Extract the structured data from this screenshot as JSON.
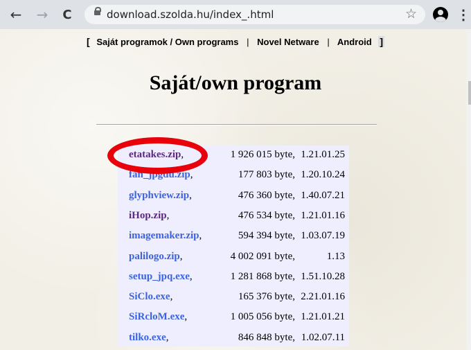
{
  "browser": {
    "url": "download.szolda.hu/index_.html",
    "back_glyph": "←",
    "forward_glyph": "→",
    "reload_glyph": "C",
    "star_glyph": "☆",
    "menu_glyph": "⋮"
  },
  "nav": {
    "open_bracket": "[",
    "items": [
      "Saját programok / Own programs",
      "Novel Netware",
      "Android"
    ],
    "separator": "|",
    "close_bracket": "]"
  },
  "page_title": "Saját/own program",
  "comma": ",",
  "files": [
    {
      "name": "etatakes.zip",
      "size": "1 926 015 byte,",
      "version": "1.21.01.25",
      "visited": true
    },
    {
      "name": "fan_jpgdu.zip",
      "size": "177 803 byte,",
      "version": "1.20.10.24",
      "visited": false
    },
    {
      "name": "glyphview.zip",
      "size": "476 360 byte,",
      "version": "1.40.07.21",
      "visited": false
    },
    {
      "name": "iHop.zip",
      "size": "476 534 byte,",
      "version": "1.21.01.16",
      "visited": true
    },
    {
      "name": "imagemaker.zip",
      "size": "594 394 byte,",
      "version": "1.03.07.19",
      "visited": false
    },
    {
      "name": "palilogo.zip",
      "size": "4 002 091 byte,",
      "version": "1.13",
      "visited": false
    },
    {
      "name": "setup_jpq.exe",
      "size": "1 281 868 byte,",
      "version": "1.51.10.28",
      "visited": false
    },
    {
      "name": "SiClo.exe",
      "size": "165 376 byte,",
      "version": "2.21.01.16",
      "visited": false
    },
    {
      "name": "SiRcloM.exe",
      "size": "1 005 056 byte,",
      "version": "1.21.01.21",
      "visited": false
    },
    {
      "name": "tilko.exe",
      "size": "846 848 byte,",
      "version": "1.02.07.11",
      "visited": false
    }
  ],
  "colors": {
    "visited_link": "#5a2a7d",
    "new_link": "#3c63df",
    "highlight_circle": "#e8000b"
  }
}
